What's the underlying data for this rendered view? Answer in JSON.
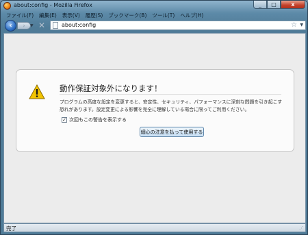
{
  "window": {
    "title": "about:config - Mozilla Firefox"
  },
  "window_controls": {
    "minimize": "_",
    "maximize": "□",
    "close": "x"
  },
  "menu": [
    "ファイル(F)",
    "編集(E)",
    "表示(V)",
    "履歴(S)",
    "ブックマーク(B)",
    "ツール(T)",
    "ヘルプ(H)"
  ],
  "nav": {
    "back_glyph": "‹",
    "forward_glyph": "›",
    "stop_glyph": "✕",
    "url": "about:config",
    "icons": [
      "back-arrow-icon",
      "forward-arrow-icon",
      "stop-icon",
      "page-icon",
      "bookmark-star-icon",
      "dropdown-icon"
    ]
  },
  "warning": {
    "title": "動作保証対象外になります！",
    "message": "プログラムの高度な設定を変更すると、安定性、セキュリティ、パフォーマンスに深刻な問題を引き起こす恐れがあります。設定変更による影響を完全に理解している場合に限ってご利用ください。",
    "checkbox_label": "次回もこの警告を表示する",
    "checkbox_checked": true,
    "checkbox_mark": "✓",
    "button_label": "細心の注意を払って使用する"
  },
  "status": {
    "text": "完了"
  },
  "colors": {
    "warning_icon": "#f2c400",
    "close_button": "#c3402a",
    "back_button": "#2d6fc6"
  }
}
